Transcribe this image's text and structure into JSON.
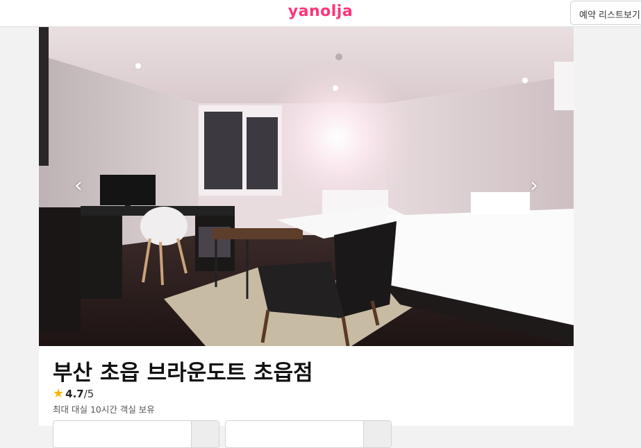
{
  "header": {
    "logo_text": "yanolja",
    "reserve_button_label": "예약 리스트보기"
  },
  "listing": {
    "name": "부산 초읍 브라운도트 초읍점",
    "rating": "4.7",
    "rating_max": "/5",
    "description": "최대 대실 10시간 객실 보유"
  },
  "colors": {
    "brand": "#ff3478",
    "star": "#f7b500"
  },
  "icons": {
    "prev": "chevron-left-icon",
    "next": "chevron-right-icon",
    "rating": "star-icon"
  }
}
